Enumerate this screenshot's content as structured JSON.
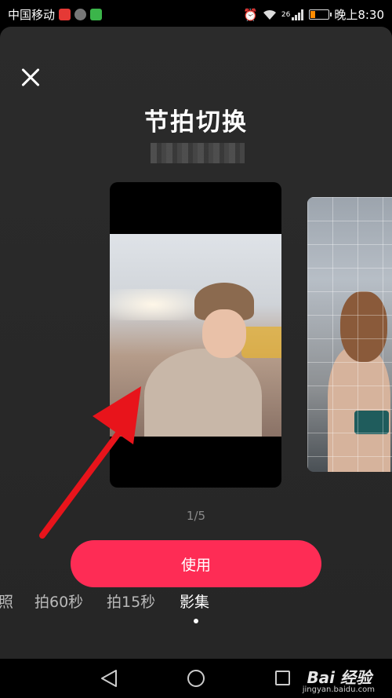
{
  "status_bar": {
    "carrier": "中国移动",
    "network": "26",
    "time": "晚上8:30"
  },
  "header": {
    "title": "节拍切换"
  },
  "carousel": {
    "page_indicator": "1/5"
  },
  "actions": {
    "use_label": "使用"
  },
  "modes": {
    "items": [
      {
        "label": "照"
      },
      {
        "label": "拍60秒"
      },
      {
        "label": "拍15秒"
      },
      {
        "label": "影集"
      }
    ],
    "active_index": 3
  },
  "watermark": {
    "brand": "Bai 经验",
    "url": "jingyan.baidu.com"
  },
  "colors": {
    "accent": "#fe2c55",
    "annotation_arrow": "#e8141b",
    "background": "#262626"
  }
}
